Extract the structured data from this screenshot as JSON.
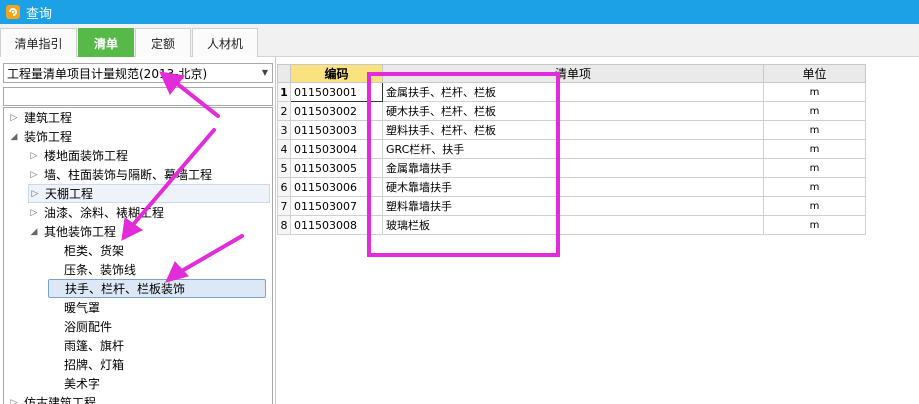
{
  "window": {
    "title": "查询"
  },
  "tabs": [
    {
      "label": "清单指引",
      "active": false
    },
    {
      "label": "清单",
      "active": true
    },
    {
      "label": "定额",
      "active": false
    },
    {
      "label": "人材机",
      "active": false
    }
  ],
  "left": {
    "spec_select": "工程量清单项目计量规范(2013-北京)",
    "search_value": "",
    "tree": [
      {
        "label": "建筑工程",
        "toggle": "collapsed"
      },
      {
        "label": "装饰工程",
        "toggle": "expanded"
      },
      {
        "label": "楼地面装饰工程",
        "toggle": "collapsed"
      },
      {
        "label": "墙、柱面装饰与隔断、幕墙工程",
        "toggle": "collapsed"
      },
      {
        "label": "天棚工程",
        "toggle": "collapsed"
      },
      {
        "label": "油漆、涂料、裱糊工程",
        "toggle": "collapsed"
      },
      {
        "label": "其他装饰工程",
        "toggle": "expanded"
      },
      {
        "label": "柜类、货架",
        "toggle": "none"
      },
      {
        "label": "压条、装饰线",
        "toggle": "none"
      },
      {
        "label": "扶手、栏杆、栏板装饰",
        "toggle": "none"
      },
      {
        "label": "暖气罩",
        "toggle": "none"
      },
      {
        "label": "浴厕配件",
        "toggle": "none"
      },
      {
        "label": "雨篷、旗杆",
        "toggle": "none"
      },
      {
        "label": "招牌、灯箱",
        "toggle": "none"
      },
      {
        "label": "美术字",
        "toggle": "none"
      },
      {
        "label": "仿古建筑工程",
        "toggle": "collapsed"
      }
    ]
  },
  "grid": {
    "columns": [
      "编码",
      "清单项",
      "单位"
    ],
    "rows": [
      {
        "n": "1",
        "code": "011503001",
        "name": "金属扶手、栏杆、栏板",
        "unit": "m"
      },
      {
        "n": "2",
        "code": "011503002",
        "name": "硬木扶手、栏杆、栏板",
        "unit": "m"
      },
      {
        "n": "3",
        "code": "011503003",
        "name": "塑料扶手、栏杆、栏板",
        "unit": "m"
      },
      {
        "n": "4",
        "code": "011503004",
        "name": "GRC栏杆、扶手",
        "unit": "m"
      },
      {
        "n": "5",
        "code": "011503005",
        "name": "金属靠墙扶手",
        "unit": "m"
      },
      {
        "n": "6",
        "code": "011503006",
        "name": "硬木靠墙扶手",
        "unit": "m"
      },
      {
        "n": "7",
        "code": "011503007",
        "name": "塑料靠墙扶手",
        "unit": "m"
      },
      {
        "n": "8",
        "code": "011503008",
        "name": "玻璃栏板",
        "unit": "m"
      }
    ]
  },
  "colors": {
    "titlebar": "#1da1e6",
    "active_tab": "#56b948",
    "code_header": "#f9e27f",
    "annotation": "#e22bd9"
  }
}
